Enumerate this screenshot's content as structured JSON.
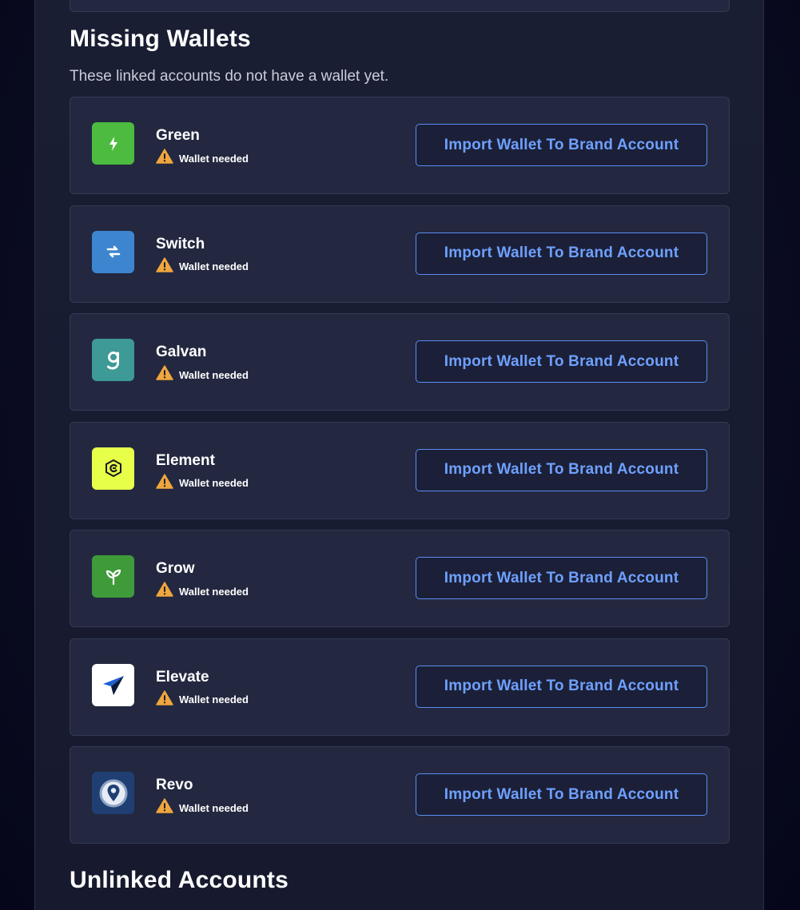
{
  "missing_section": {
    "title": "Missing Wallets",
    "description": "These linked accounts do not have a wallet yet."
  },
  "unlinked_section": {
    "title": "Unlinked Accounts"
  },
  "status_label": "Wallet needed",
  "import_button_label": "Import Wallet To Brand Account",
  "accounts": [
    {
      "name": "Green",
      "icon": "bolt-icon",
      "color": "#4cbb3f"
    },
    {
      "name": "Switch",
      "icon": "switch-arrows-icon",
      "color": "#3d86cf"
    },
    {
      "name": "Galvan",
      "icon": "letter-g-icon",
      "color": "#3d9a96"
    },
    {
      "name": "Element",
      "icon": "element-hexagon-icon",
      "color": "#e8ff4a"
    },
    {
      "name": "Grow",
      "icon": "sprout-icon",
      "color": "#3f9b3a"
    },
    {
      "name": "Elevate",
      "icon": "paper-plane-icon",
      "color": "#ffffff"
    },
    {
      "name": "Revo",
      "icon": "location-pin-icon",
      "color": "#1f3f73"
    }
  ]
}
